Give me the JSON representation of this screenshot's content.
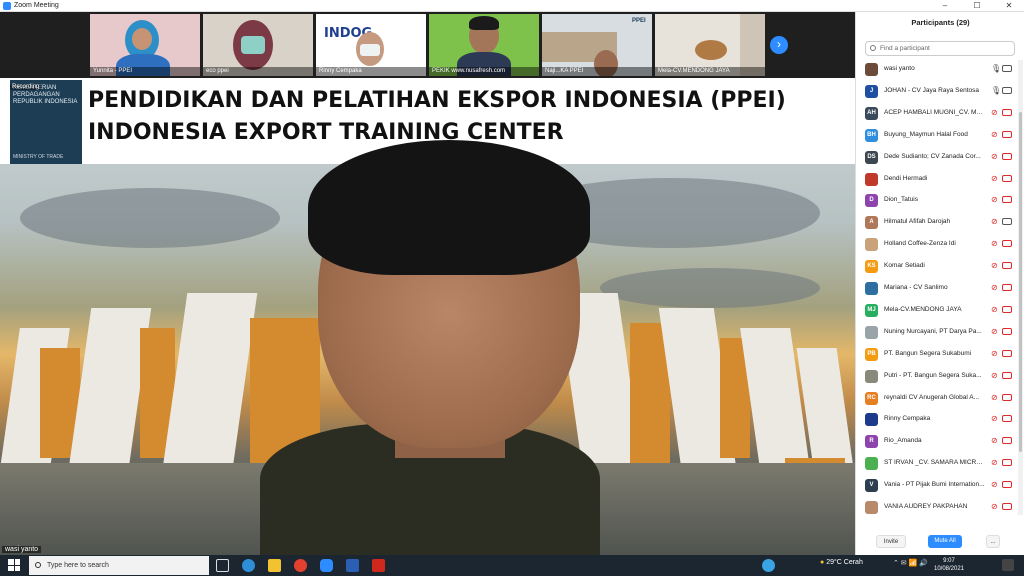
{
  "window": {
    "title": "Zoom Meeting",
    "minimize": "–",
    "maximize": "☐",
    "close": "✕"
  },
  "thumbnails": [
    {
      "name": "Yunnita - PPEI"
    },
    {
      "name": "eco ppei"
    },
    {
      "name": "Rinny Cempaka"
    },
    {
      "name": "PEKIK www.nusafresh.com"
    },
    {
      "name": "Naji...KA PPEI"
    },
    {
      "name": "Mela-CV.MENDONG JAYA"
    }
  ],
  "presentation": {
    "recording": "Recording",
    "logo_text": "KEMENTERIAN PERDAGANGAN REPUBLIK INDONESIA",
    "logo_ministry": "MINISTRY OF TRADE",
    "title_line1": "PENDIDIKAN  DAN PELATIHAN EKSPOR INDONESIA (PPEI)",
    "title_line2": "INDONESIA EXPORT TRAINING CENTER",
    "speaker_name": "wasi yanto"
  },
  "participants_panel": {
    "title": "Participants (29)",
    "search_placeholder": "Find a participant",
    "invite_label": "Invite",
    "mute_all_label": "Mute All",
    "more_label": "...",
    "participants": [
      {
        "name": "wasi yanto",
        "initials": "",
        "avatar_color": "#6b4b3a",
        "muted": false,
        "video_off": false
      },
      {
        "name": "JOHAN - CV Jaya Raya Sentosa",
        "initials": "J",
        "avatar_color": "#1f4fa3",
        "muted": false,
        "video_off": false
      },
      {
        "name": "ACEP HAMBALI MUGNI_CV. MU...",
        "initials": "AH",
        "avatar_color": "#3a4a5c",
        "muted": true,
        "video_off": true
      },
      {
        "name": "Buyung_Maymun Halal Food",
        "initials": "BH",
        "avatar_color": "#2f8fdf",
        "muted": true,
        "video_off": true
      },
      {
        "name": "Dede Sudianto; CV Zanada Cor...",
        "initials": "DS",
        "avatar_color": "#3c4650",
        "muted": true,
        "video_off": true
      },
      {
        "name": "Dendi Hermadi",
        "initials": "",
        "avatar_color": "#c0392b",
        "muted": true,
        "video_off": true
      },
      {
        "name": "Dion_Tatuis",
        "initials": "D",
        "avatar_color": "#8e44ad",
        "muted": true,
        "video_off": true
      },
      {
        "name": "Hilmatul Afifah Darojah",
        "initials": "A",
        "avatar_color": "#b0785a",
        "muted": true,
        "video_off": false
      },
      {
        "name": "Holland Coffee-Zenza Idi",
        "initials": "",
        "avatar_color": "#c9a27a",
        "muted": true,
        "video_off": true
      },
      {
        "name": "Komar Setiadi",
        "initials": "KS",
        "avatar_color": "#f39c12",
        "muted": true,
        "video_off": true
      },
      {
        "name": "Mariana - CV Sanlimo",
        "initials": "",
        "avatar_color": "#2c6fa0",
        "muted": true,
        "video_off": true
      },
      {
        "name": "Mela-CV.MENDONG JAYA",
        "initials": "MJ",
        "avatar_color": "#27ae60",
        "muted": true,
        "video_off": true
      },
      {
        "name": "Nuning Nurcayani, PT Darya Pa...",
        "initials": "",
        "avatar_color": "#9aa3a8",
        "muted": true,
        "video_off": true
      },
      {
        "name": "PT. Bangun Segera Sukabumi",
        "initials": "PB",
        "avatar_color": "#f39c12",
        "muted": true,
        "video_off": true
      },
      {
        "name": "Putri - PT. Bangun Segera Suka...",
        "initials": "",
        "avatar_color": "#8a8a7a",
        "muted": true,
        "video_off": true
      },
      {
        "name": "reynaldi CV Anugerah Global A...",
        "initials": "RC",
        "avatar_color": "#e67e22",
        "muted": true,
        "video_off": true
      },
      {
        "name": "Rinny Cempaka",
        "initials": "",
        "avatar_color": "#1e3a8a",
        "muted": true,
        "video_off": true
      },
      {
        "name": "Rio_Amanda",
        "initials": "R",
        "avatar_color": "#8e44ad",
        "muted": true,
        "video_off": true
      },
      {
        "name": "ST IRVAN _CV. SAMARA MICRO...",
        "initials": "",
        "avatar_color": "#4caf50",
        "muted": true,
        "video_off": true
      },
      {
        "name": "Vania - PT Pijak Bumi Internation...",
        "initials": "V",
        "avatar_color": "#2c3e50",
        "muted": true,
        "video_off": true
      },
      {
        "name": "VANIA AUDREY PAKPAHAN",
        "initials": "",
        "avatar_color": "#b88a6a",
        "muted": true,
        "video_off": true
      }
    ]
  },
  "taskbar": {
    "search_placeholder": "Type here to search",
    "weather": "29°C  Cerah",
    "time": "9:07",
    "date": "10/08/2021"
  },
  "colors": {
    "zoom_blue": "#2d8cff",
    "muted_red": "#e02828",
    "taskbar": "#1c2630"
  }
}
